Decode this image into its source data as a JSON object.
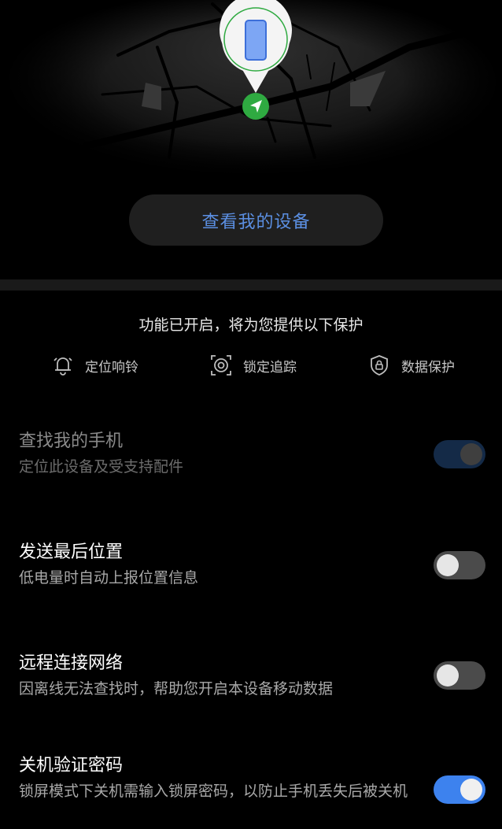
{
  "map": {
    "pin_accent": "#2faa41",
    "nav_badge": "#2faa41"
  },
  "view_device_label": "查看我的设备",
  "protection": {
    "title": "功能已开启，将为您提供以下保护",
    "features": [
      {
        "icon": "bell-icon",
        "label": "定位响铃"
      },
      {
        "icon": "target-lock-icon",
        "label": "锁定追踪"
      },
      {
        "icon": "shield-lock-icon",
        "label": "数据保护"
      }
    ]
  },
  "settings": [
    {
      "title": "查找我的手机",
      "subtitle": "定位此设备及受支持配件",
      "state": "on-disabled"
    },
    {
      "title": "发送最后位置",
      "subtitle": "低电量时自动上报位置信息",
      "state": "off"
    },
    {
      "title": "远程连接网络",
      "subtitle": "因离线无法查找时，帮助您开启本设备移动数据",
      "state": "off"
    },
    {
      "title": "关机验证密码",
      "subtitle": "锁屏模式下关机需输入锁屏密码，以防止手机丢失后被关机",
      "state": "on"
    }
  ],
  "colors": {
    "accent": "#3d82ee",
    "link": "#5b8fe2"
  }
}
